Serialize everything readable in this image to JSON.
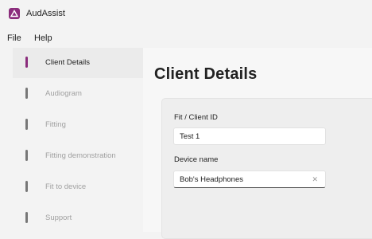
{
  "app": {
    "title": "AudAssist",
    "icon": "app-triangle-icon",
    "accent_color": "#8b2d7c"
  },
  "menu": {
    "items": [
      {
        "label": "File"
      },
      {
        "label": "Help"
      }
    ]
  },
  "sidebar": {
    "items": [
      {
        "label": "Client Details",
        "active": true
      },
      {
        "label": "Audiogram",
        "active": false
      },
      {
        "label": "Fitting",
        "active": false
      },
      {
        "label": "Fitting demonstration",
        "active": false
      },
      {
        "label": "Fit to device",
        "active": false
      },
      {
        "label": "Support",
        "active": false
      }
    ]
  },
  "main": {
    "title": "Client Details",
    "form": {
      "client_id": {
        "label": "Fit / Client ID",
        "value": "Test 1"
      },
      "device_name": {
        "label": "Device name",
        "value": "Bob's Headphones",
        "clear_icon": "close-icon"
      }
    }
  }
}
